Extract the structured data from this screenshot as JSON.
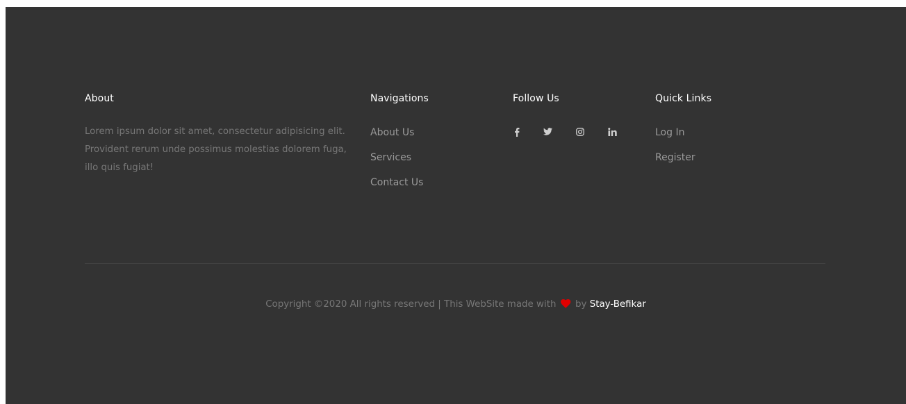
{
  "about": {
    "heading": "About",
    "text": "Lorem ipsum dolor sit amet, consectetur adipisicing elit. Provident rerum unde possimus molestias dolorem fuga, illo quis fugiat!"
  },
  "navigations": {
    "heading": "Navigations",
    "items": [
      {
        "label": "About Us"
      },
      {
        "label": "Services"
      },
      {
        "label": "Contact Us"
      }
    ]
  },
  "follow": {
    "heading": "Follow Us",
    "icons": [
      "facebook-icon",
      "twitter-icon",
      "instagram-icon",
      "linkedin-icon"
    ]
  },
  "quick_links": {
    "heading": "Quick Links",
    "items": [
      {
        "label": "Log In"
      },
      {
        "label": "Register"
      }
    ]
  },
  "copyright": {
    "prefix": "Copyright ©2020 All rights reserved | This WebSite made with",
    "by": "by",
    "brand": "Stay-Befikar"
  },
  "colors": {
    "background": "#333333",
    "heading": "#ffffff",
    "muted_text": "#777777",
    "link": "#9a9a9a",
    "heart": "#e00000"
  }
}
